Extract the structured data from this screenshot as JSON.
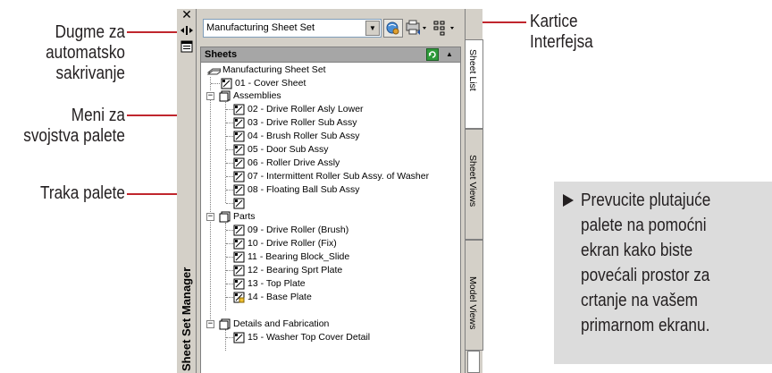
{
  "callouts": {
    "autohide": "Dugme za\nautomatsko\nsakrivanje",
    "properties_menu": "Meni za\nsvojstva palete",
    "palette_bar": "Traka palete",
    "interface_tabs": "Kartice\nInterfejsa"
  },
  "palette_bar": {
    "close_glyph": "✕",
    "title": "Sheet Set Manager"
  },
  "toolbar": {
    "sheet_set_value": "Manufacturing Sheet Set",
    "dropdown_glyph": "▼"
  },
  "sheets_header": {
    "title": "Sheets",
    "collapse_glyph": "▲"
  },
  "tree": {
    "root": "Manufacturing Sheet Set",
    "cover_sheet": "01 - Cover Sheet",
    "groups": [
      {
        "name": "Assemblies",
        "items": [
          "02 - Drive Roller Asly Lower",
          "03 - Drive Roller Sub Assy",
          "04 - Brush Roller Sub Assy",
          "05 - Door Sub Assy",
          "06 - Roller Drive Assly",
          "07 - Intermittent Roller Sub Assy. of Washer",
          "08 - Floating Ball Sub Assy"
        ]
      },
      {
        "name": "Parts",
        "items": [
          "09 - Drive Roller (Brush)",
          "10 - Drive Roller (Fix)",
          "11 - Bearing Block_Slide",
          "12 - Bearing Sprt Plate",
          "13 - Top Plate",
          "14 - Base Plate"
        ]
      },
      {
        "name": "Details and Fabrication",
        "items": [
          "15 - Washer Top Cover Detail"
        ]
      }
    ],
    "expander_glyph": "−"
  },
  "tabs": {
    "sheet_list": "Sheet List",
    "sheet_views": "Sheet Views",
    "model_views": "Model Views"
  },
  "tip": {
    "text": "Prevucite plutajuće\npalete na pomoćni\nekran kako biste\npovećali prostor za\ncrtanje na vašem\nprimarnom ekranu."
  },
  "colors": {
    "callout_line": "#c0262d",
    "panel_gray": "#d4d0c8",
    "tip_bg": "#dcdcdc"
  }
}
